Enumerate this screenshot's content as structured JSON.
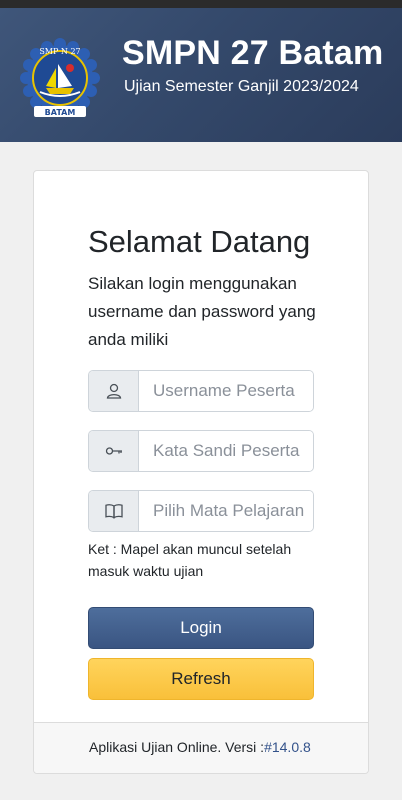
{
  "header": {
    "school_name": "SMPN 27 Batam",
    "exam_name": "Ujian Semester Ganjil 2023/2024",
    "logo_text_top": "SMP N 27",
    "logo_text_bottom": "BATAM",
    "background_color": "#34496b"
  },
  "login": {
    "title": "Selamat Datang",
    "subtitle": "Silakan login menggunakan username dan password yang anda miliki",
    "username_placeholder": "Username Peserta",
    "password_placeholder": "Kata Sandi Peserta",
    "subject_placeholder": "Pilih Mata Pelajaran",
    "note": "Ket : Mapel akan muncul setelah masuk waktu ujian",
    "login_label": "Login",
    "refresh_label": "Refresh",
    "icons": {
      "username": "user-icon",
      "password": "key-icon",
      "subject": "book-icon"
    }
  },
  "footer": {
    "text": "Aplikasi Ujian Online. Versi :",
    "version": "#14.0.8"
  },
  "colors": {
    "login_button": "#3f5c8a",
    "refresh_button": "#fcc844",
    "version_link": "#33528a"
  }
}
